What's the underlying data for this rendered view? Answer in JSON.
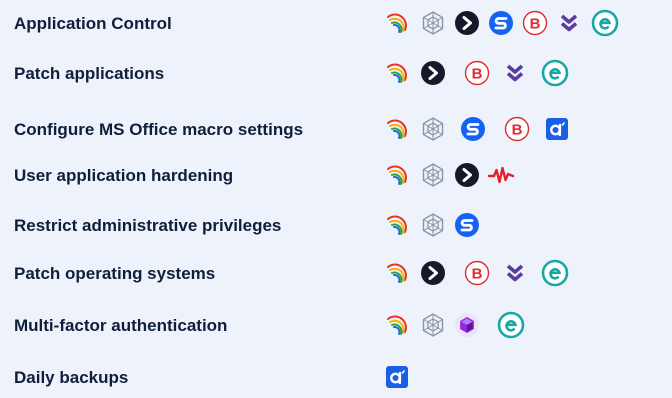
{
  "rows": [
    {
      "label": "Application Control",
      "icons": [
        "rainbow-swirl-icon",
        "hexagon-network-icon",
        "dark-arrow-circle-icon",
        "blue-s-icon",
        "bitdefender-b-icon",
        "chevrons-down-icon",
        "eset-e-icon"
      ]
    },
    {
      "label": "Patch applications",
      "icons": [
        "rainbow-swirl-icon",
        "dark-arrow-circle-icon",
        "bitdefender-b-icon",
        "chevrons-down-icon",
        "eset-e-icon"
      ]
    },
    {
      "label": "Configure MS Office macro settings",
      "icons": [
        "rainbow-swirl-icon",
        "hexagon-network-icon",
        "blue-s-icon",
        "bitdefender-b-icon",
        "acronis-a-icon"
      ]
    },
    {
      "label": "User application hardening",
      "icons": [
        "rainbow-swirl-icon",
        "hexagon-network-icon",
        "dark-arrow-circle-icon",
        "red-pulse-icon"
      ]
    },
    {
      "label": "Restrict administrative privileges",
      "icons": [
        "rainbow-swirl-icon",
        "hexagon-network-icon",
        "blue-s-icon"
      ]
    },
    {
      "label": "Patch operating systems",
      "icons": [
        "rainbow-swirl-icon",
        "dark-arrow-circle-icon",
        "bitdefender-b-icon",
        "chevrons-down-icon",
        "eset-e-icon"
      ]
    },
    {
      "label": "Multi-factor authentication",
      "icons": [
        "rainbow-swirl-icon",
        "hexagon-network-icon",
        "purple-cube-icon",
        "eset-e-icon"
      ]
    },
    {
      "label": "Daily backups",
      "icons": [
        "acronis-a-icon"
      ]
    }
  ],
  "colors": {
    "background": "#eef3fb",
    "text": "#0f1f3a",
    "dark_circle": "#15192a",
    "blue_s": "#1463f3",
    "bitdefender_red": "#e12b31",
    "chevron_purple": "#5d3ca0",
    "eset_teal": "#17a7a4",
    "acronis_blue": "#1960e6",
    "pulse_red": "#e5202e",
    "cube_purple": "#8f2bd8"
  }
}
